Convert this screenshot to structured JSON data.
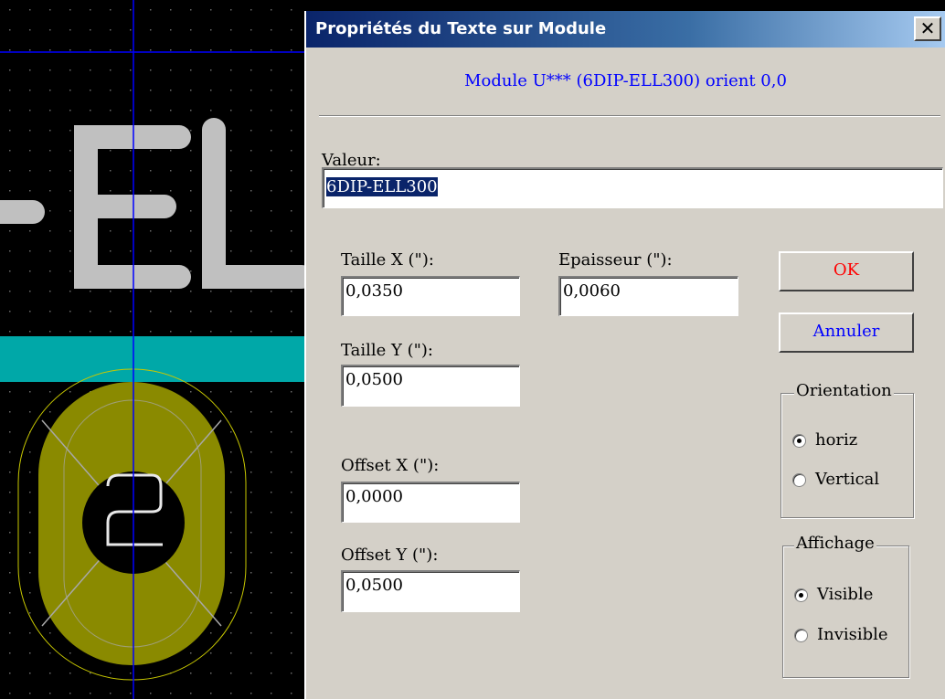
{
  "dialog": {
    "title": "Propriétés du Texte sur Module",
    "close_glyph": "✕",
    "module_info": "Module U*** (6DIP-ELL300) orient 0,0"
  },
  "value": {
    "label": "Valeur:",
    "text": "6DIP-ELL300"
  },
  "size_x": {
    "label": "Taille X (\"):",
    "value": "0,0350"
  },
  "thickness": {
    "label": "Epaisseur (\"):",
    "value": "0,0060"
  },
  "size_y": {
    "label": "Taille Y (\"):",
    "value": "0,0500"
  },
  "offset_x": {
    "label": "Offset X (\"):",
    "value": "0,0000"
  },
  "offset_y": {
    "label": "Offset Y (\"):",
    "value": "0,0500"
  },
  "buttons": {
    "ok": "OK",
    "cancel": "Annuler",
    "ok_color": "#ff0000",
    "cancel_color": "#0000ff"
  },
  "orientation": {
    "legend": "Orientation",
    "options": [
      "horiz",
      "Vertical"
    ],
    "selected": "horiz"
  },
  "display": {
    "legend": "Affichage",
    "options": [
      "Visible",
      "Invisible"
    ],
    "selected": "Visible"
  },
  "pcb": {
    "pad_number": "2",
    "colors": {
      "pad": "#8a8a00",
      "track": "#00aaaa",
      "text": "#c0c0c0",
      "crosshair": "#0000ff"
    }
  }
}
